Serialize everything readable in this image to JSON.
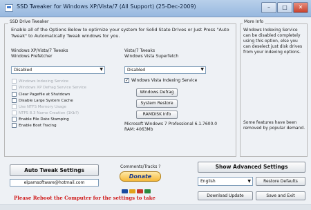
{
  "window": {
    "title": "SSD Tweaker for Windows XP/Vista/7 (All Support) (25-Dec-2009)",
    "minimize_glyph": "–",
    "maximize_glyph": "□",
    "close_glyph": "✕"
  },
  "tweaker": {
    "legend": "SSD Drive Tweaker",
    "intro": "Enable all of the Options Below to optimize your system for Solid State Drives or Just Press \"Auto Tweak\" to Automatically Tweak windows for you.",
    "xp_group_label": "Windows XP/Vista/7 Tweaks",
    "prefetcher_label": "Windows Prefetcher",
    "prefetcher_value": "Disabled",
    "options": [
      {
        "label": "Windows Indexing Service",
        "enabled": false
      },
      {
        "label": "Windows XP Defrag Service Service",
        "enabled": false
      },
      {
        "label": "Clear Pagefile at Shutdown",
        "enabled": true
      },
      {
        "label": "Disable Large System Cache",
        "enabled": true
      },
      {
        "label": "Use NTFS Memory Usage",
        "enabled": false
      },
      {
        "label": "NTFS 8.3 Name Creation (1Kb?)",
        "enabled": false
      },
      {
        "label": "Enable File Date Stamping",
        "enabled": true
      },
      {
        "label": "Enable Boot Tracing",
        "enabled": true
      }
    ],
    "vista_group_label": "Vista/7 Tweaks",
    "superfetch_label": "Windows Vista Superfetch",
    "superfetch_value": "Disabled",
    "indexing_label": "Windows Vista Indexing Service",
    "indexing_mark": "✓",
    "defrag_button": "Windows Defrag",
    "restore_button": "System Restore",
    "info_button": "RAMDISK Info",
    "os_version": "Microsoft Windows 7 Professional 6.1.7600.0",
    "ram": "RAM: 4063Mb"
  },
  "more": {
    "legend": "More Info",
    "info_text": "Windows Indexing Service can be disabled completely using this option, else you can deselect just disk drives from your indexing options.",
    "note_text": "Some features have been removed by popular demand."
  },
  "bottom": {
    "auto_tweak": "Auto Tweak Settings",
    "show_advanced": "Show Advanced Settings",
    "email": "elpamsoftware@hotmail.com",
    "comments": "Comments/Tracks ?",
    "donate": "Donate",
    "language_value": "English",
    "restore_defaults": "Restore Defaults",
    "download_update": "Download Update",
    "save_exit": "Save and Exit",
    "warning": "Please Reboot the Computer for the settings to take"
  },
  "colors": {
    "warning": "#d01b1b",
    "donate_gold": "#f6b93a",
    "titlebar": "#97b8df"
  }
}
